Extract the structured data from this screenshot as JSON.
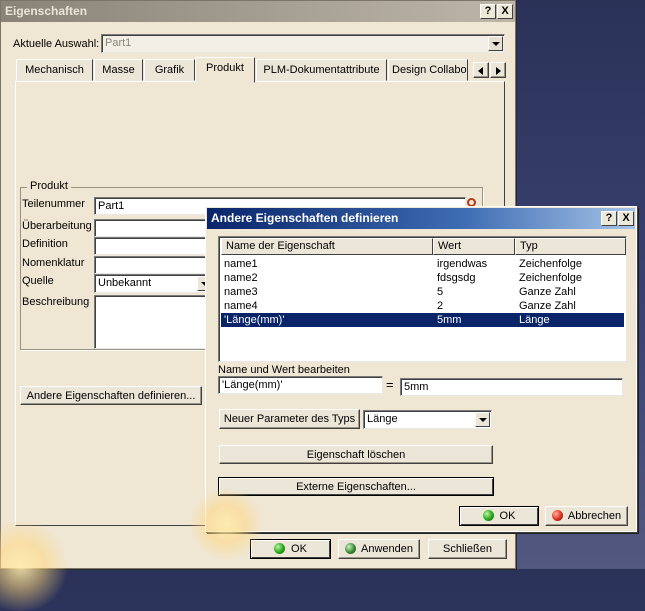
{
  "main_dialog": {
    "title": "Eigenschaften",
    "current_selection_label": "Aktuelle Auswahl:",
    "current_selection_value": "Part1",
    "tabs": [
      {
        "label": "Mechanisch"
      },
      {
        "label": "Masse"
      },
      {
        "label": "Grafik"
      },
      {
        "label": "Produkt"
      },
      {
        "label": "PLM-Dokumentattribute"
      },
      {
        "label": "Design Collabo"
      }
    ],
    "active_tab": "Produkt",
    "product_group": {
      "title": "Produkt",
      "part_number_label": "Teilenummer",
      "part_number_value": "Part1",
      "revision_label": "Überarbeitung",
      "revision_value": "",
      "definition_label": "Definition",
      "definition_value": "",
      "nomenclature_label": "Nomenklatur",
      "nomenclature_value": "",
      "source_label": "Quelle",
      "source_value": "Unbekannt",
      "description_label": "Beschreibung",
      "description_value": ""
    },
    "define_other_button": "Andere Eigenschaften definieren...",
    "ok_button": "OK",
    "apply_button": "Anwenden",
    "close_button": "Schließen"
  },
  "sub_dialog": {
    "title": "Andere Eigenschaften definieren",
    "columns": [
      "Name der Eigenschaft",
      "Wert",
      "Typ"
    ],
    "rows": [
      {
        "name": "name1",
        "value": "irgendwas",
        "type": "Zeichenfolge"
      },
      {
        "name": "name2",
        "value": "fdsgsdg",
        "type": "Zeichenfolge"
      },
      {
        "name": "name3",
        "value": "5",
        "type": "Ganze Zahl"
      },
      {
        "name": "name4",
        "value": "2",
        "type": "Ganze Zahl"
      },
      {
        "name": "'Länge(mm)'",
        "value": "5mm",
        "type": "Länge"
      }
    ],
    "selected_row": 4,
    "edit_label": "Name und Wert bearbeiten",
    "edit_name_value": "'Länge(mm)'",
    "equals": "=",
    "edit_value_value": "5mm",
    "new_param_button": "Neuer Parameter des Typs",
    "param_type_value": "Länge",
    "delete_button": "Eigenschaft löschen",
    "external_button": "Externe Eigenschaften...",
    "ok_button": "OK",
    "cancel_button": "Abbrechen"
  },
  "title_buttons": {
    "help": "?",
    "close": "X"
  },
  "colors": {
    "dialog_bg": "#f0e6d4",
    "active_title": "#0a246a",
    "inactive_title": "#8a8478",
    "selection": "#0a246a",
    "desktop": "#2b3258"
  }
}
